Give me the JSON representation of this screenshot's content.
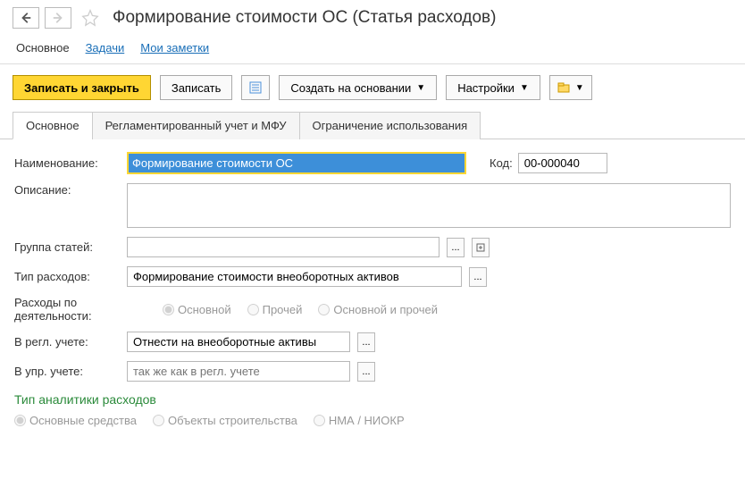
{
  "header": {
    "title": "Формирование стоимости ОС (Статья расходов)"
  },
  "topnav": {
    "item_main": "Основное",
    "item_tasks": "Задачи",
    "item_notes": "Мои заметки"
  },
  "toolbar": {
    "save_close": "Записать и закрыть",
    "save": "Записать",
    "create_based": "Создать на основании",
    "settings": "Настройки"
  },
  "tabs": {
    "main": "Основное",
    "reg": "Регламентированный учет и МФУ",
    "limit": "Ограничение использования"
  },
  "form": {
    "name_label": "Наименование:",
    "name_value": "Формирование стоимости ОС",
    "code_label": "Код:",
    "code_value": "00-000040",
    "desc_label": "Описание:",
    "group_label": "Группа статей:",
    "type_label": "Тип расходов:",
    "type_value": "Формирование стоимости внеоборотных активов",
    "activity_label": "Расходы по деятельности:",
    "activity_main": "Основной",
    "activity_other": "Прочей",
    "activity_both": "Основной и прочей",
    "reg_label": "В регл. учете:",
    "reg_value": "Отнести на внеоборотные активы",
    "upr_label": "В упр. учете:",
    "upr_placeholder": "так же как в регл. учете",
    "analytics_title": "Тип аналитики расходов",
    "analytics_os": "Основные средства",
    "analytics_obj": "Объекты строительства",
    "analytics_nma": "НМА / НИОКР"
  }
}
